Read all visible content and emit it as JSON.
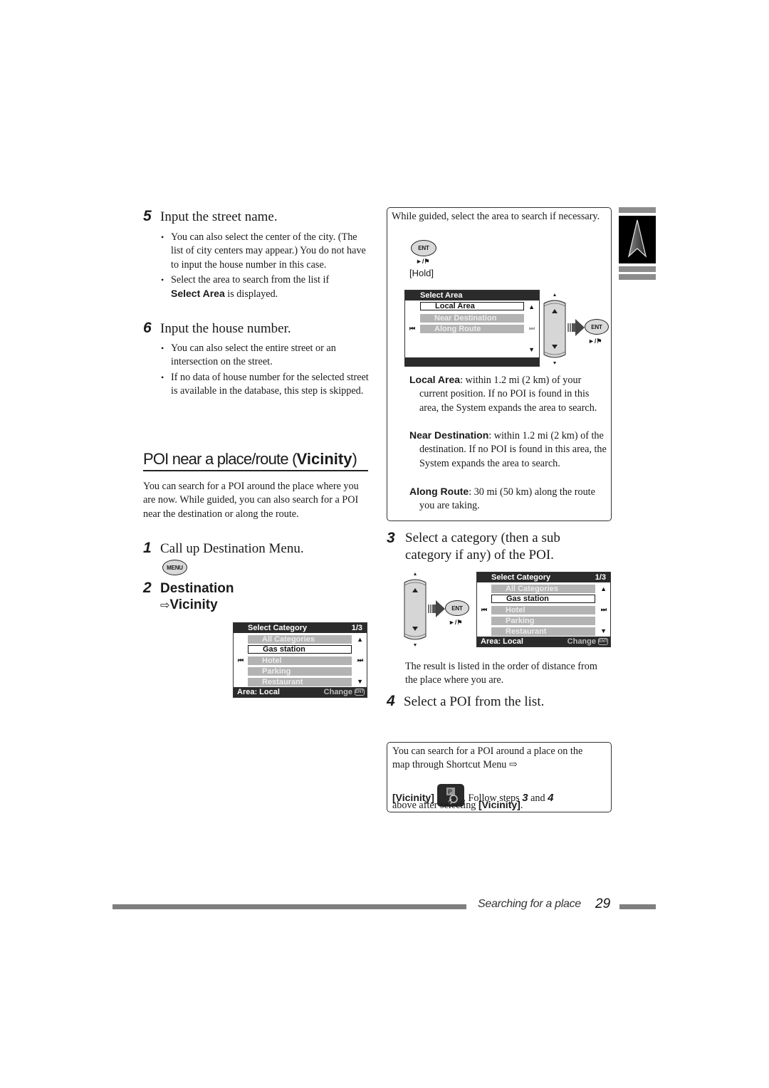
{
  "left_column": {
    "step5": {
      "number": "5",
      "title": "Input the street name.",
      "bullets": [
        "You can also select the center of the city. (The list of city centers may appear.) You do not have to input the house number in this case.",
        "Select the area to search from the list if"
      ],
      "bullet2_keyword": "Select Area",
      "bullet2_suffix": " is displayed."
    },
    "step6": {
      "number": "6",
      "title": "Input the house number.",
      "bullets": [
        "You can also select the entire street or an intersection on the street.",
        "If no data of house number for the selected street is available in the database, this step is skipped."
      ]
    },
    "section": {
      "title_prefix": "POI near a place/route (",
      "title_keyword": "Vicinity",
      "title_suffix": ")",
      "intro": "You can search for a POI around the place where you are now. While guided, you can also search for a POI near the destination or along the route."
    },
    "step1": {
      "number": "1",
      "title": "Call up Destination Menu.",
      "button": "MENU"
    },
    "step2": {
      "number": "2",
      "line1": "Destination",
      "arrow": "⇨",
      "line2": "Vicinity"
    },
    "category_screen": {
      "header": "Select Category",
      "page": "1/3",
      "items": [
        "All Categories",
        "Gas station",
        "Hotel",
        "Parking",
        "Restaurant"
      ],
      "selected_index": 1,
      "footer_left": "Area: Local",
      "footer_right": "Change",
      "footer_badge": "ENT"
    }
  },
  "right_column": {
    "area_box": {
      "intro": "While guided, select the area to search if necessary.",
      "button": "ENT",
      "button_caption": "►/⚑",
      "hold_label": "[Hold]",
      "area_screen": {
        "header": "Select Area",
        "items": [
          "Local Area",
          "Near Destination",
          "Along Route"
        ],
        "selected_index": 0
      },
      "ent_button": "ENT",
      "ent_caption": "►/⚑",
      "definitions": [
        {
          "term": "Local Area",
          "text": ": within 1.2 mi (2 km) of your current position. If no POI is found in this area, the System expands the area to search."
        },
        {
          "term": "Near Destination",
          "text": ": within 1.2 mi (2 km) of the destination. If no POI is found in this area, the System expands the area to search."
        },
        {
          "term": "Along Route",
          "text": ": 30 mi (50 km) along the route you are taking."
        }
      ]
    },
    "step3": {
      "number": "3",
      "title": "Select a category (then a sub category if any) of the POI.",
      "ent_button": "ENT",
      "ent_caption": "►/⚑",
      "category_screen": {
        "header": "Select Category",
        "page": "1/3",
        "items": [
          "All Categories",
          "Gas station",
          "Hotel",
          "Parking",
          "Restaurant"
        ],
        "selected_index": 1,
        "footer_left": "Area: Local",
        "footer_right": "Change",
        "footer_badge": "ENT"
      },
      "note": "The result is listed in the order of distance from the place where you are."
    },
    "step4": {
      "number": "4",
      "title": "Select a POI from the list."
    },
    "shortcut_box": {
      "line1": "You can search for a POI around a place on the map through Shortcut Menu ⇨",
      "keyword": "[Vicinity]",
      "follow_prefix": ". Follow steps ",
      "step_a": "3",
      "and": " and ",
      "step_b": "4",
      "line3_prefix": "above after selecting ",
      "line3_keyword": "[Vicinity]",
      "line3_suffix": "."
    }
  },
  "footer": {
    "section_name": "Searching for a place",
    "page_number": "29"
  },
  "side_tab": {
    "icon": "navigation-arrow-icon"
  }
}
